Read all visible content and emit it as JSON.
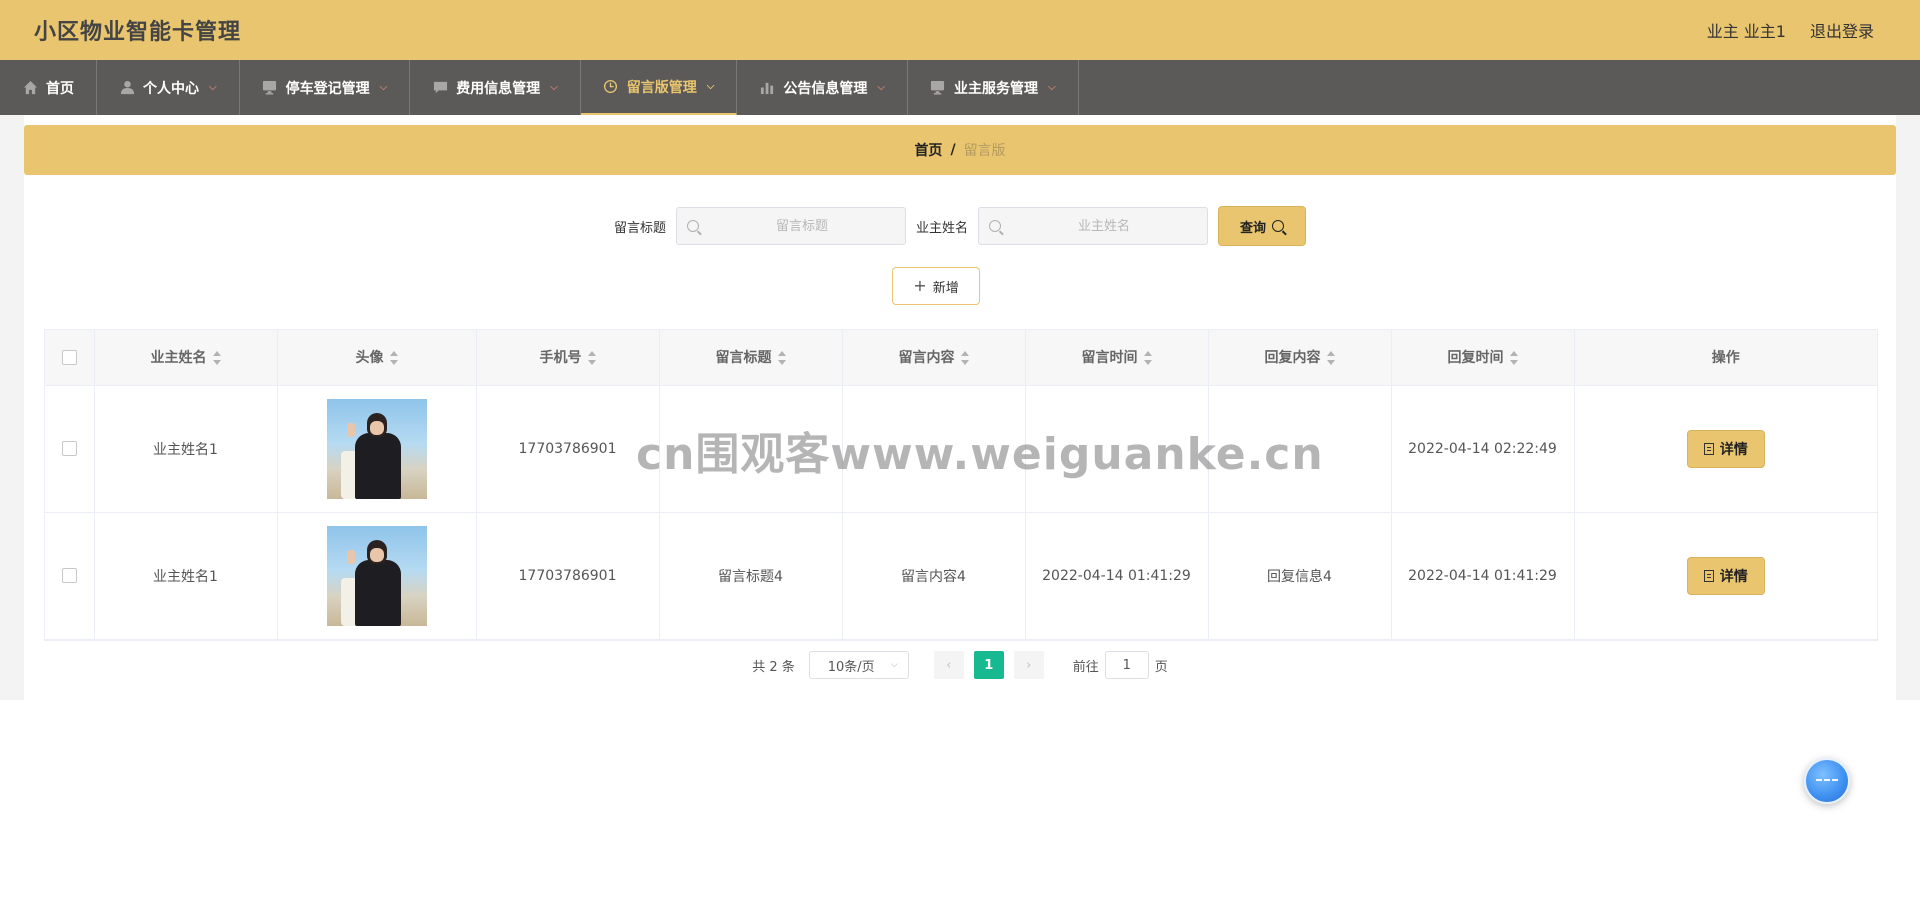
{
  "header": {
    "title": "小区物业智能卡管理",
    "user_label": "业主 业主1",
    "logout_label": "退出登录"
  },
  "nav": {
    "items": [
      {
        "label": "首页",
        "icon": "home-icon"
      },
      {
        "label": "个人中心",
        "icon": "user-icon"
      },
      {
        "label": "停车登记管理",
        "icon": "monitor-icon"
      },
      {
        "label": "费用信息管理",
        "icon": "chat-icon"
      },
      {
        "label": "留言版管理",
        "icon": "clock-icon",
        "active": true
      },
      {
        "label": "公告信息管理",
        "icon": "bar-chart-icon"
      },
      {
        "label": "业主服务管理",
        "icon": "monitor-icon"
      }
    ]
  },
  "breadcrumb": {
    "home": "首页",
    "separator": "/",
    "current": "留言版"
  },
  "search": {
    "title_label": "留言标题",
    "title_placeholder": "留言标题",
    "name_label": "业主姓名",
    "name_placeholder": "业主姓名",
    "query_label": "查询"
  },
  "add_label": "新增",
  "table": {
    "headers": [
      "业主姓名",
      "头像",
      "手机号",
      "留言标题",
      "留言内容",
      "留言时间",
      "回复内容",
      "回复时间",
      "操作"
    ],
    "rows": [
      {
        "name": "业主姓名1",
        "phone": "17703786901",
        "title": "",
        "content": "",
        "time": "",
        "reply": "",
        "reply_time": "2022-04-14 02:22:49",
        "action": "详情"
      },
      {
        "name": "业主姓名1",
        "phone": "17703786901",
        "title": "留言标题4",
        "content": "留言内容4",
        "time": "2022-04-14 01:41:29",
        "reply": "回复信息4",
        "reply_time": "2022-04-14 01:41:29",
        "action": "详情"
      }
    ]
  },
  "pagination": {
    "total": "共 2 条",
    "page_size": "10条/页",
    "current_page": "1",
    "goto_label": "前往",
    "goto_value": "1",
    "page_suffix": "页"
  },
  "watermark": "cn围观客www.weiguanke.cn",
  "colors": {
    "accent": "#e8c56e",
    "nav_bg": "#5c5a58",
    "page_active": "#16b990"
  }
}
